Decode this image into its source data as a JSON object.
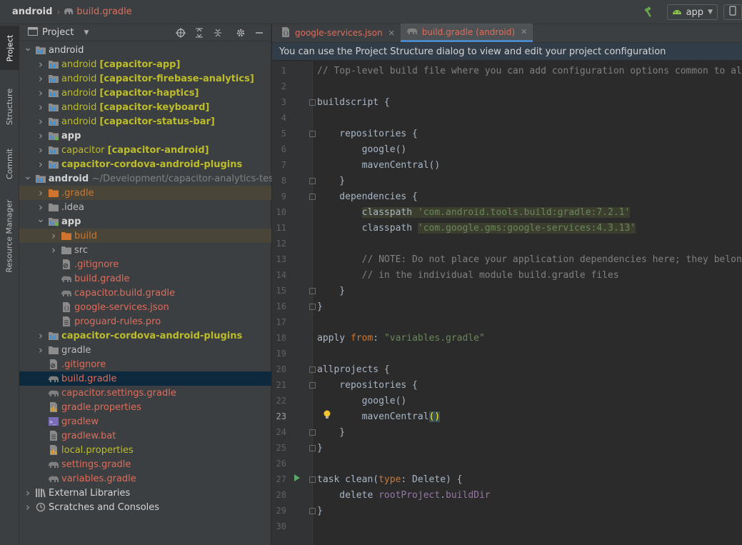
{
  "breadcrumb": {
    "root": "android",
    "file": "build.gradle"
  },
  "toolbar": {
    "run_config": "app"
  },
  "tool_windows": [
    "Project",
    "Structure",
    "Commit",
    "Resource Manager"
  ],
  "project_panel": {
    "title": "Project",
    "tree": [
      {
        "indent": 0,
        "arrow": "down",
        "icon": "module-folder",
        "parts": [
          {
            "t": "android",
            "c": "c-white"
          }
        ]
      },
      {
        "indent": 1,
        "arrow": "right",
        "icon": "module-folder",
        "parts": [
          {
            "t": "android ",
            "c": "c-olive"
          },
          {
            "t": "[capacitor-app]",
            "c": "c-olive c-bold"
          }
        ]
      },
      {
        "indent": 1,
        "arrow": "right",
        "icon": "module-folder",
        "parts": [
          {
            "t": "android ",
            "c": "c-olive"
          },
          {
            "t": "[capacitor-firebase-analytics]",
            "c": "c-olive c-bold"
          }
        ]
      },
      {
        "indent": 1,
        "arrow": "right",
        "icon": "module-folder",
        "parts": [
          {
            "t": "android ",
            "c": "c-olive"
          },
          {
            "t": "[capacitor-haptics]",
            "c": "c-olive c-bold"
          }
        ]
      },
      {
        "indent": 1,
        "arrow": "right",
        "icon": "module-folder",
        "parts": [
          {
            "t": "android ",
            "c": "c-olive"
          },
          {
            "t": "[capacitor-keyboard]",
            "c": "c-olive c-bold"
          }
        ]
      },
      {
        "indent": 1,
        "arrow": "right",
        "icon": "module-folder",
        "parts": [
          {
            "t": "android ",
            "c": "c-olive"
          },
          {
            "t": "[capacitor-status-bar]",
            "c": "c-olive c-bold"
          }
        ]
      },
      {
        "indent": 1,
        "arrow": "right",
        "icon": "app-folder",
        "parts": [
          {
            "t": "app",
            "c": "c-white c-bold"
          }
        ]
      },
      {
        "indent": 1,
        "arrow": "right",
        "icon": "module-folder",
        "parts": [
          {
            "t": "capacitor ",
            "c": "c-olive"
          },
          {
            "t": "[capacitor-android]",
            "c": "c-olive c-bold"
          }
        ]
      },
      {
        "indent": 1,
        "arrow": "right",
        "icon": "module-folder",
        "parts": [
          {
            "t": "capacitor-cordova-android-plugins",
            "c": "c-olive c-bold"
          }
        ]
      },
      {
        "indent": 0,
        "arrow": "down",
        "icon": "module-folder",
        "parts": [
          {
            "t": "android ",
            "c": "c-white c-bold"
          },
          {
            "t": "~/Development/capacitor-analytics-test/c",
            "c": "c-gray"
          }
        ]
      },
      {
        "indent": 1,
        "arrow": "right",
        "icon": "folder-orange",
        "hl": true,
        "parts": [
          {
            "t": ".gradle",
            "c": "c-orange"
          }
        ]
      },
      {
        "indent": 1,
        "arrow": "right",
        "icon": "folder-gray",
        "parts": [
          {
            "t": ".idea",
            "c": "c-norm"
          }
        ]
      },
      {
        "indent": 1,
        "arrow": "down",
        "icon": "app-folder",
        "parts": [
          {
            "t": "app",
            "c": "c-white c-bold"
          }
        ]
      },
      {
        "indent": 2,
        "arrow": "right",
        "icon": "folder-orange",
        "hl": true,
        "parts": [
          {
            "t": "build",
            "c": "c-orange"
          }
        ]
      },
      {
        "indent": 2,
        "arrow": "right",
        "icon": "folder-gray",
        "parts": [
          {
            "t": "src",
            "c": "c-norm"
          }
        ]
      },
      {
        "indent": 2,
        "arrow": "none",
        "icon": "ignore-file",
        "parts": [
          {
            "t": ".gitignore",
            "c": "c-red"
          }
        ]
      },
      {
        "indent": 2,
        "arrow": "none",
        "icon": "gradle-elephant",
        "parts": [
          {
            "t": "build.gradle",
            "c": "c-red"
          }
        ]
      },
      {
        "indent": 2,
        "arrow": "none",
        "icon": "gradle-elephant",
        "parts": [
          {
            "t": "capacitor.build.gradle",
            "c": "c-red"
          }
        ]
      },
      {
        "indent": 2,
        "arrow": "none",
        "icon": "json-file",
        "parts": [
          {
            "t": "google-services.json",
            "c": "c-red"
          }
        ]
      },
      {
        "indent": 2,
        "arrow": "none",
        "icon": "text-file",
        "parts": [
          {
            "t": "proguard-rules.pro",
            "c": "c-red"
          }
        ]
      },
      {
        "indent": 1,
        "arrow": "right",
        "icon": "module-folder",
        "parts": [
          {
            "t": "capacitor-cordova-android-plugins",
            "c": "c-olive c-bold"
          }
        ]
      },
      {
        "indent": 1,
        "arrow": "right",
        "icon": "folder-gray",
        "parts": [
          {
            "t": "gradle",
            "c": "c-norm"
          }
        ]
      },
      {
        "indent": 1,
        "arrow": "none",
        "icon": "ignore-file",
        "parts": [
          {
            "t": ".gitignore",
            "c": "c-red"
          }
        ]
      },
      {
        "indent": 1,
        "arrow": "none",
        "icon": "gradle-elephant",
        "sel": true,
        "parts": [
          {
            "t": "build.gradle",
            "c": "c-red"
          }
        ]
      },
      {
        "indent": 1,
        "arrow": "none",
        "icon": "gradle-elephant",
        "parts": [
          {
            "t": "capacitor.settings.gradle",
            "c": "c-red"
          }
        ]
      },
      {
        "indent": 1,
        "arrow": "none",
        "icon": "properties-file",
        "parts": [
          {
            "t": "gradle.properties",
            "c": "c-red"
          }
        ]
      },
      {
        "indent": 1,
        "arrow": "none",
        "icon": "shell-file",
        "parts": [
          {
            "t": "gradlew",
            "c": "c-red"
          }
        ]
      },
      {
        "indent": 1,
        "arrow": "none",
        "icon": "text-file",
        "parts": [
          {
            "t": "gradlew.bat",
            "c": "c-red"
          }
        ]
      },
      {
        "indent": 1,
        "arrow": "none",
        "icon": "properties-file",
        "parts": [
          {
            "t": "local.properties",
            "c": "c-olive"
          }
        ]
      },
      {
        "indent": 1,
        "arrow": "none",
        "icon": "gradle-elephant",
        "parts": [
          {
            "t": "settings.gradle",
            "c": "c-red"
          }
        ]
      },
      {
        "indent": 1,
        "arrow": "none",
        "icon": "gradle-elephant",
        "parts": [
          {
            "t": "variables.gradle",
            "c": "c-red"
          }
        ]
      },
      {
        "indent": 0,
        "arrow": "right",
        "icon": "libraries",
        "parts": [
          {
            "t": "External Libraries",
            "c": "c-white"
          }
        ]
      },
      {
        "indent": 0,
        "arrow": "right",
        "icon": "scratches",
        "parts": [
          {
            "t": "Scratches and Consoles",
            "c": "c-white"
          }
        ]
      }
    ]
  },
  "editor": {
    "tabs": [
      {
        "label": "google-services.json",
        "active": false
      },
      {
        "label": "build.gradle (android)",
        "active": true
      }
    ],
    "notice": "You can use the Project Structure dialog to view and edit your project configuration",
    "current_line": 23,
    "lines": [
      [
        {
          "t": "// Top-level build file where you can add configuration options common to all",
          "c": "k-comment"
        }
      ],
      [],
      [
        {
          "t": "buildscript {",
          "c": ""
        }
      ],
      [],
      [
        {
          "t": "    repositories {",
          "c": ""
        }
      ],
      [
        {
          "t": "        google()",
          "c": ""
        }
      ],
      [
        {
          "t": "        mavenCentral()",
          "c": ""
        }
      ],
      [
        {
          "t": "    }",
          "c": ""
        }
      ],
      [
        {
          "t": "    dependencies {",
          "c": ""
        }
      ],
      [
        {
          "t": "        ",
          "c": ""
        },
        {
          "t": "classpath ",
          "c": "k-hl"
        },
        {
          "t": "'com.android.tools.build:gradle:7.2.1'",
          "c": "k-hlstr"
        }
      ],
      [
        {
          "t": "        classpath ",
          "c": ""
        },
        {
          "t": "'com.google.gms:google-services:4.3.13'",
          "c": "k-hlstr"
        }
      ],
      [],
      [
        {
          "t": "        // NOTE: Do not place your application dependencies here; they belong",
          "c": "k-comment"
        }
      ],
      [
        {
          "t": "        // in the individual module build.gradle files",
          "c": "k-comment"
        }
      ],
      [
        {
          "t": "    }",
          "c": ""
        }
      ],
      [
        {
          "t": "}",
          "c": ""
        }
      ],
      [],
      [
        {
          "t": "apply ",
          "c": ""
        },
        {
          "t": "from",
          "c": "k-kw"
        },
        {
          "t": ": ",
          "c": ""
        },
        {
          "t": "\"variables.gradle\"",
          "c": "k-str"
        }
      ],
      [],
      [
        {
          "t": "allprojects {",
          "c": ""
        }
      ],
      [
        {
          "t": "    repositories {",
          "c": ""
        }
      ],
      [
        {
          "t": "        google()",
          "c": ""
        }
      ],
      [
        {
          "t": "        mavenCentral",
          "c": ""
        },
        {
          "t": "()",
          "c": "bracket"
        }
      ],
      [
        {
          "t": "    }",
          "c": ""
        }
      ],
      [
        {
          "t": "}",
          "c": ""
        }
      ],
      [],
      [
        {
          "t": "task clean(",
          "c": ""
        },
        {
          "t": "type",
          "c": "k-kw"
        },
        {
          "t": ": Delete) {",
          "c": ""
        }
      ],
      [
        {
          "t": "    delete ",
          "c": ""
        },
        {
          "t": "rootProject",
          "c": "k-purple"
        },
        {
          "t": ".",
          "c": ""
        },
        {
          "t": "buildDir",
          "c": "k-purple"
        }
      ],
      [
        {
          "t": "}",
          "c": ""
        }
      ],
      []
    ]
  }
}
